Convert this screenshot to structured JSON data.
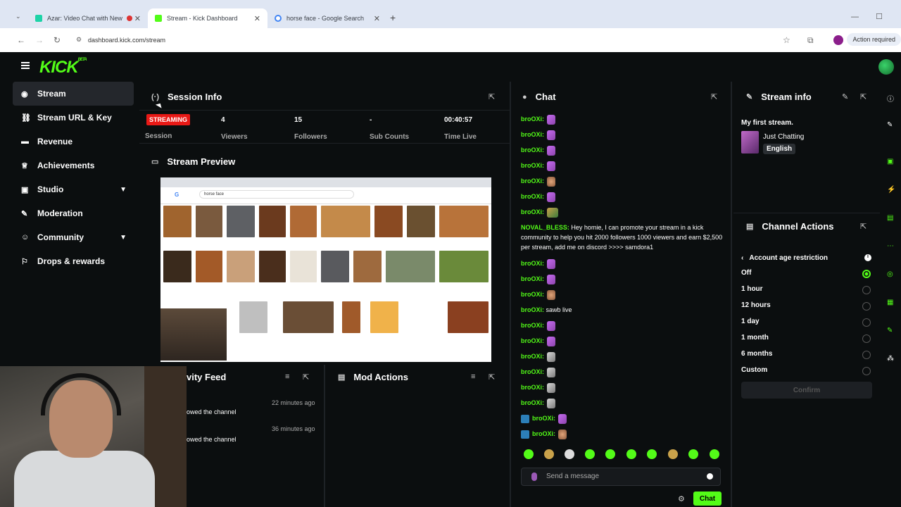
{
  "browser": {
    "tabs": [
      {
        "title": "Azar: Video Chat with New",
        "fav": "#1dd3a7"
      },
      {
        "title": "Stream - Kick Dashboard",
        "fav": "#53fc18"
      },
      {
        "title": "horse face - Google Search",
        "fav": "#4285f4"
      }
    ],
    "url": "dashboard.kick.com/stream",
    "action_required": "Action required"
  },
  "logo": {
    "text": "KICK",
    "beta": "BETA"
  },
  "sidebar": {
    "items": [
      {
        "label": "Stream",
        "icon": "broadcast-icon"
      },
      {
        "label": "Stream URL & Key",
        "icon": "link-icon"
      },
      {
        "label": "Revenue",
        "icon": "money-icon"
      },
      {
        "label": "Achievements",
        "icon": "trophy-icon"
      },
      {
        "label": "Studio",
        "icon": "studio-icon"
      },
      {
        "label": "Moderation",
        "icon": "wrench-icon"
      },
      {
        "label": "Community",
        "icon": "community-icon"
      },
      {
        "label": "Drops & rewards",
        "icon": "gift-icon"
      }
    ]
  },
  "session": {
    "title": "Session Info",
    "status": "STREAMING",
    "session_label": "Session",
    "viewers": "4",
    "viewers_label": "Viewers",
    "followers": "15",
    "followers_label": "Followers",
    "subs": "-",
    "subs_label": "Sub Counts",
    "time": "00:40:57",
    "time_label": "Time Live"
  },
  "preview": {
    "title": "Stream Preview",
    "google_query": "horse face"
  },
  "activity": {
    "title": "vity Feed",
    "items": [
      {
        "text": "owed the channel",
        "time": "22 minutes ago"
      },
      {
        "text": "owed the channel",
        "time": "36 minutes ago"
      }
    ]
  },
  "mod_actions": {
    "title": "Mod Actions"
  },
  "chat": {
    "title": "Chat",
    "messages": [
      {
        "user": "broOXi:",
        "text": "",
        "emote": "p"
      },
      {
        "user": "broOXi:",
        "text": "",
        "emote": "p"
      },
      {
        "user": "broOXi:",
        "text": "",
        "emote": "p"
      },
      {
        "user": "broOXi:",
        "text": "",
        "emote": "p"
      },
      {
        "user": "broOXi:",
        "text": "",
        "emote": "f"
      },
      {
        "user": "broOXi:",
        "text": "",
        "emote": "p"
      },
      {
        "user": "broOXi:",
        "text": "",
        "emote": "g"
      },
      {
        "user": "NOVAL_BLESS:",
        "text": "Hey homie, I can promote your stream in a kick community to help you hit 2000 followers 1000 viewers and earn $2,500 per stream, add me on discord >>>> samdora1",
        "emote": ""
      },
      {
        "user": "broOXi:",
        "text": "",
        "emote": "p"
      },
      {
        "user": "broOXi:",
        "text": "",
        "emote": "p"
      },
      {
        "user": "broOXi:",
        "text": "",
        "emote": "f"
      },
      {
        "user": "broOXi:",
        "text": "sawb live",
        "emote": ""
      },
      {
        "user": "broOXi:",
        "text": "",
        "emote": "p"
      },
      {
        "user": "broOXi:",
        "text": "",
        "emote": "p"
      },
      {
        "user": "broOXi:",
        "text": "",
        "emote": "g"
      },
      {
        "user": "broOXi:",
        "text": "",
        "emote": "g"
      },
      {
        "user": "broOXi:",
        "text": "",
        "emote": "g"
      },
      {
        "user": "broOXi:",
        "text": "",
        "emote": "g"
      },
      {
        "user": "broOXi:",
        "text": "",
        "emote": "p"
      },
      {
        "user": "broOXi:",
        "text": "",
        "emote": "f"
      }
    ],
    "placeholder": "Send a message",
    "send_label": "Chat"
  },
  "stream_info": {
    "title": "Stream info",
    "stream_title": "My first stream.",
    "category": "Just Chatting",
    "language": "English"
  },
  "channel_actions": {
    "title": "Channel Actions",
    "section": "Account age restriction",
    "options": [
      "Off",
      "1 hour",
      "12 hours",
      "1 day",
      "1 month",
      "6 months",
      "Custom"
    ],
    "selected": "Off",
    "confirm": "Confirm"
  }
}
